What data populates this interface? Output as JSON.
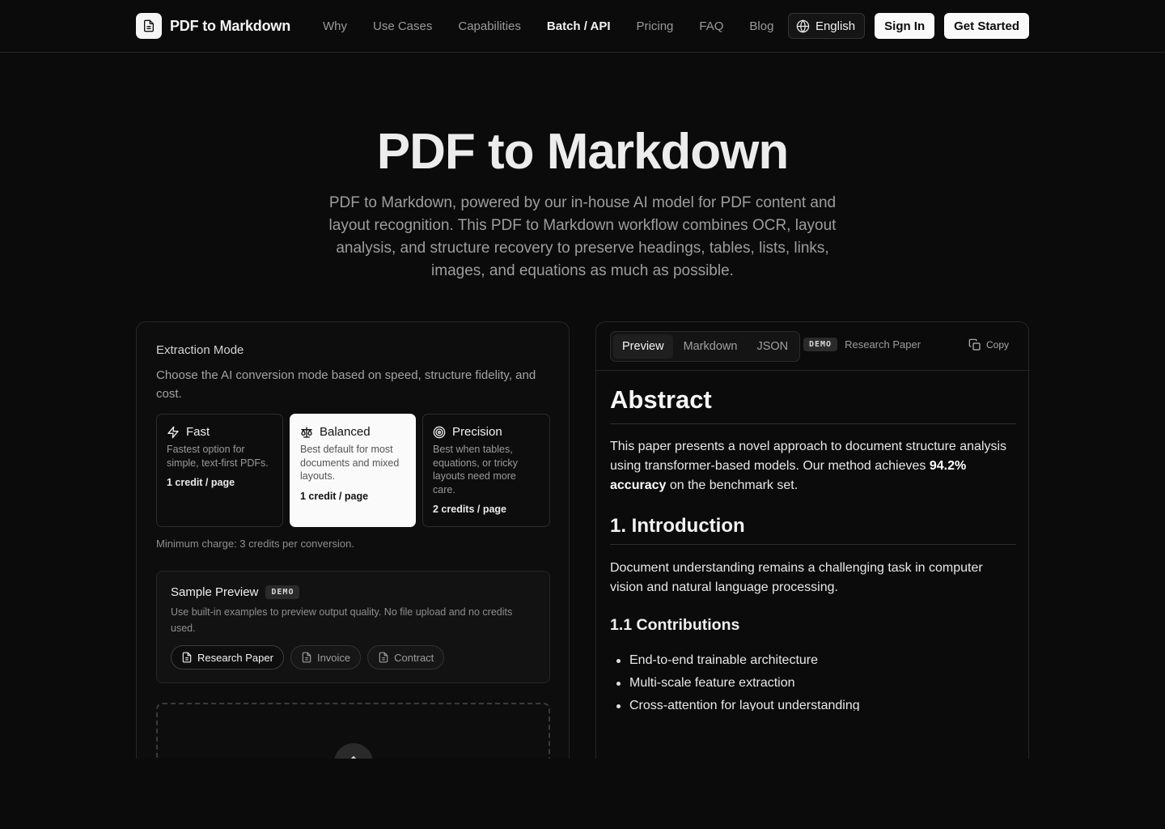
{
  "nav": {
    "brand": "PDF to Markdown",
    "links": [
      "Why",
      "Use Cases",
      "Capabilities",
      "Batch / API",
      "Pricing",
      "FAQ",
      "Blog"
    ],
    "active_link": "Batch / API",
    "language": "English",
    "sign_in": "Sign In",
    "get_started": "Get Started"
  },
  "hero": {
    "title": "PDF to Markdown",
    "description": "PDF to Markdown, powered by our in-house AI model for PDF content and layout recognition. This PDF to Markdown workflow combines OCR, layout analysis, and structure recovery to preserve headings, tables, lists, links, images, and equations as much as possible."
  },
  "extraction": {
    "title": "Extraction Mode",
    "description": "Choose the AI conversion mode based on speed, structure fidelity, and cost.",
    "modes": [
      {
        "name": "Fast",
        "icon": "lightning-icon",
        "desc": "Fastest option for simple, text-first PDFs.",
        "credits": "1 credit / page",
        "selected": false
      },
      {
        "name": "Balanced",
        "icon": "scale-icon",
        "desc": "Best default for most documents and mixed layouts.",
        "credits": "1 credit / page",
        "selected": true
      },
      {
        "name": "Precision",
        "icon": "target-icon",
        "desc": "Best when tables, equations, or tricky layouts need more care.",
        "credits": "2 credits / page",
        "selected": false
      }
    ],
    "min_charge": "Minimum charge: 3 credits per conversion."
  },
  "sample": {
    "title": "Sample Preview",
    "badge": "DEMO",
    "description": "Use built-in examples to preview output quality. No file upload and no credits used.",
    "buttons": [
      "Research Paper",
      "Invoice",
      "Contract"
    ],
    "active": "Research Paper"
  },
  "preview": {
    "tabs": [
      "Preview",
      "Markdown",
      "JSON"
    ],
    "active_tab": "Preview",
    "badge": "DEMO",
    "document": "Research Paper",
    "copy": "Copy",
    "h1": "Abstract",
    "p1_start": "This paper presents a novel approach to document structure analysis using transformer-based models. Our method achieves ",
    "p1_bold": "94.2% accuracy",
    "p1_end": " on the benchmark set.",
    "h2": "1. Introduction",
    "p2": "Document understanding remains a challenging task in computer vision and natural language processing.",
    "h3": "1.1 Contributions",
    "list": [
      "End-to-end trainable architecture",
      "Multi-scale feature extraction",
      "Cross-attention for layout understanding"
    ]
  }
}
